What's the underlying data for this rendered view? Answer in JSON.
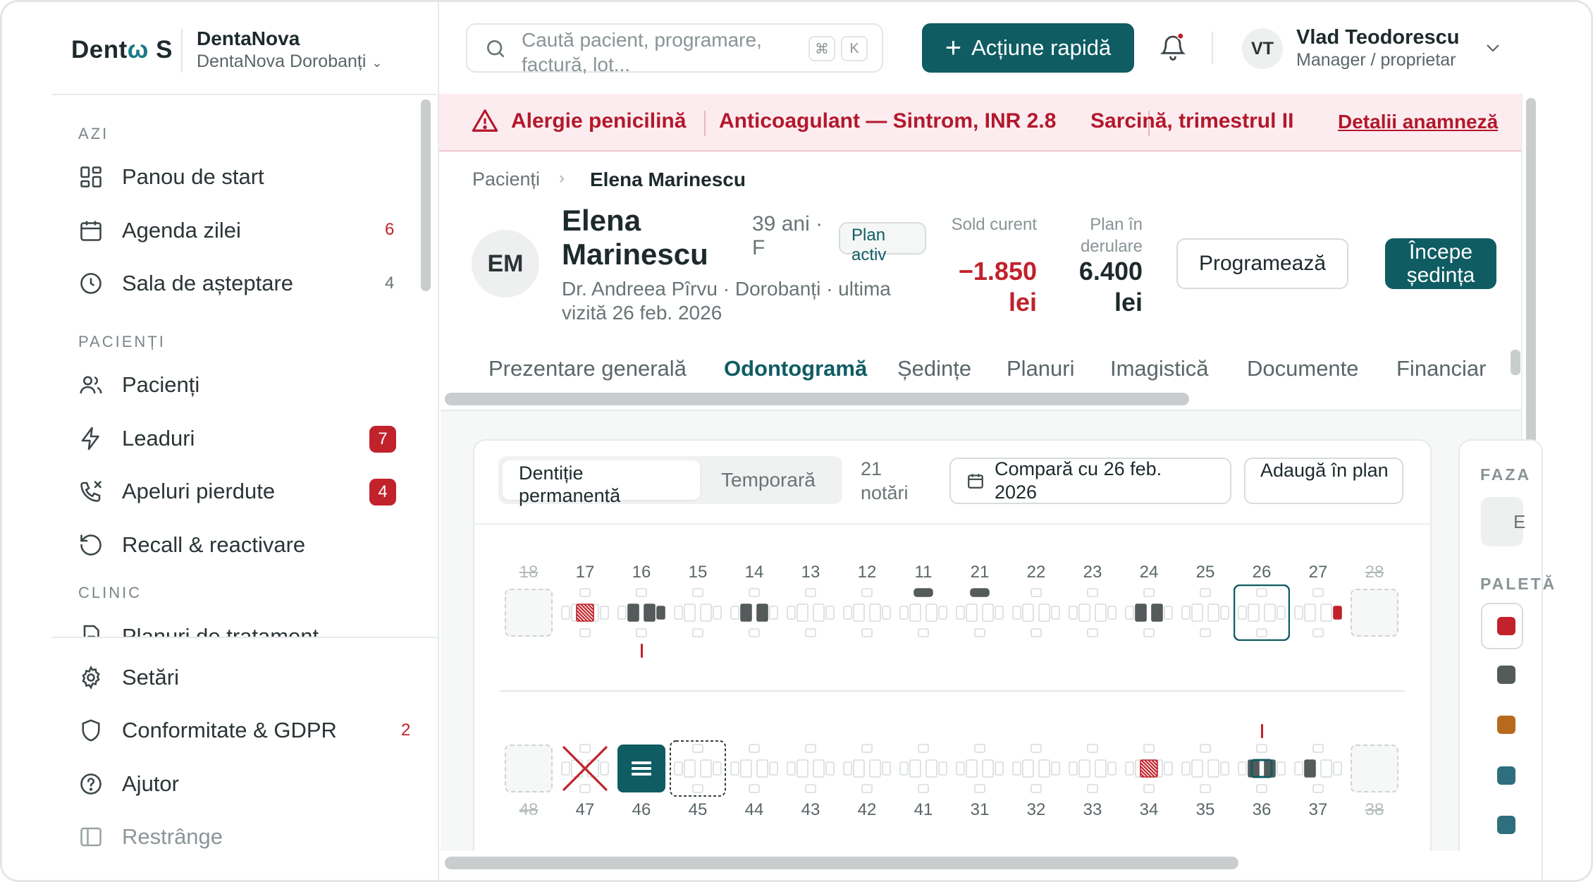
{
  "brand": {
    "logo_left": "Dent",
    "logo_mid": "ω",
    "logo_right": "S",
    "clinic_name": "DentaNova",
    "clinic_location": "DentaNova Dorobanți"
  },
  "sidebar": {
    "section_today": "AZI",
    "section_patients": "PACIENȚI",
    "section_clinic": "CLINIC",
    "items": [
      {
        "label": "Panou de start",
        "icon": "dashboard-icon",
        "count": ""
      },
      {
        "label": "Agenda zilei",
        "icon": "calendar-icon",
        "count": "6"
      },
      {
        "label": "Sala de așteptare",
        "icon": "clock-icon",
        "count": "4"
      },
      {
        "label": "Pacienți",
        "icon": "users-icon",
        "count": ""
      },
      {
        "label": "Leaduri",
        "icon": "lightning-icon",
        "count": "7"
      },
      {
        "label": "Apeluri pierdute",
        "icon": "missed-call-icon",
        "count": "4"
      },
      {
        "label": "Recall & reactivare",
        "icon": "rotate-icon",
        "count": ""
      },
      {
        "label": "Planuri de tratament",
        "icon": "document-icon",
        "count": ""
      }
    ],
    "bottom": [
      {
        "label": "Setări",
        "icon": "gear-icon",
        "count": ""
      },
      {
        "label": "Conformitate & GDPR",
        "icon": "shield-icon",
        "count": "2"
      },
      {
        "label": "Ajutor",
        "icon": "help-icon",
        "count": ""
      },
      {
        "label": "Restrânge",
        "icon": "collapse-icon",
        "count": ""
      }
    ]
  },
  "topbar": {
    "search_placeholder": "Caută pacient, programare, factură, lot...",
    "kbd1": "⌘",
    "kbd2": "K",
    "quick_action": "Acțiune rapidă",
    "user_initials": "VT",
    "user_name": "Vlad Teodorescu",
    "user_role": "Manager / proprietar"
  },
  "alerts": {
    "items": [
      "Alergie penicilină",
      "Anticoagulant — Sintrom, INR 2.8",
      "Sarcină, trimestrul II"
    ],
    "link": "Detalii anamneză"
  },
  "breadcrumb": {
    "root": "Pacienți",
    "current": "Elena Marinescu"
  },
  "patient": {
    "initials": "EM",
    "name": "Elena Marinescu",
    "age": "39 ani · F",
    "plan_badge": "Plan activ",
    "meta": "Dr. Andreea Pîrvu · Dorobanți · ultima vizită 26 feb. 2026",
    "balance_label": "Sold curent",
    "balance_value": "−1.850 lei",
    "plan_label": "Plan în derulare",
    "plan_value": "6.400 lei",
    "btn_schedule": "Programează",
    "btn_start": "Începe ședința"
  },
  "tabs": [
    "Prezentare generală",
    "Odontogramă",
    "Ședințe",
    "Planuri",
    "Imagistică",
    "Documente",
    "Financiar"
  ],
  "active_tab": "Odontogramă",
  "odontogram": {
    "seg_permanent": "Dentiție permanentă",
    "seg_temporary": "Temporară",
    "notes_count": "21 notări",
    "compare": "Compară cu 26 feb. 2026",
    "add_plan": "Adaugă în plan",
    "upper": [
      "18",
      "17",
      "16",
      "15",
      "14",
      "13",
      "12",
      "11",
      "21",
      "22",
      "23",
      "24",
      "25",
      "26",
      "27",
      "28"
    ],
    "lower": [
      "48",
      "47",
      "46",
      "45",
      "44",
      "43",
      "42",
      "41",
      "31",
      "32",
      "33",
      "34",
      "35",
      "36",
      "37",
      "38"
    ]
  },
  "phases": {
    "title": "FAZA",
    "button": "E",
    "palette_title": "PALETĂ",
    "colors": [
      "#c1222c",
      "#555a5b",
      "#b76a1e",
      "#2f6f7d",
      "#2f6f7d"
    ]
  }
}
